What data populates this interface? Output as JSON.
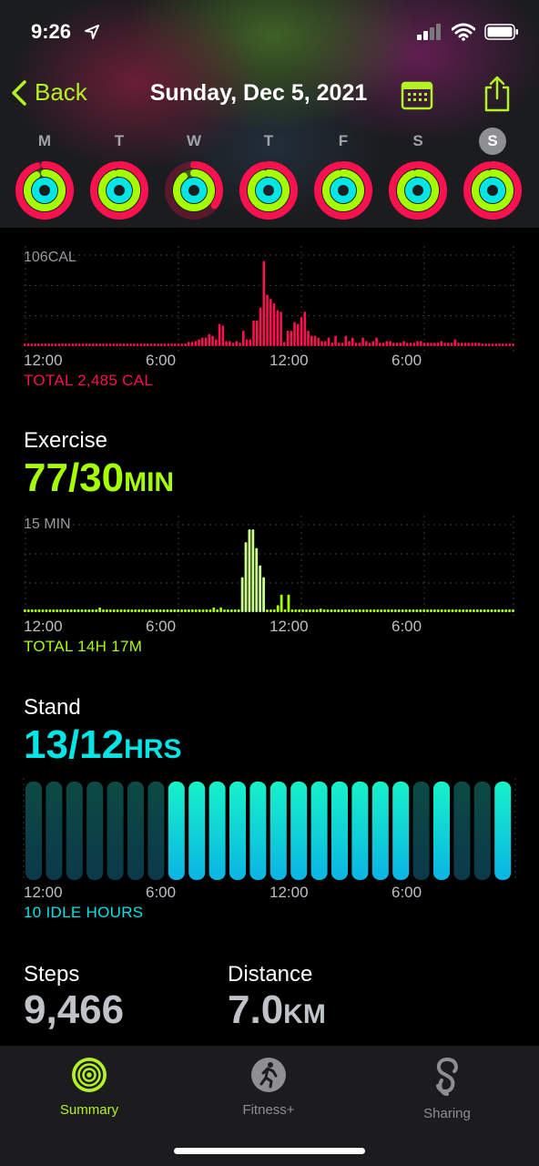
{
  "status": {
    "time": "9:26"
  },
  "nav": {
    "back_label": "Back",
    "title": "Sunday, Dec 5, 2021"
  },
  "week": [
    {
      "letter": "M",
      "selected": false,
      "move": 0.95,
      "exercise": 0.92,
      "stand": 0.95
    },
    {
      "letter": "T",
      "selected": false,
      "move": 0.97,
      "exercise": 0.95,
      "stand": 0.95
    },
    {
      "letter": "W",
      "selected": false,
      "move": 0.35,
      "exercise": 0.9,
      "stand": 0.95
    },
    {
      "letter": "T",
      "selected": false,
      "move": 0.97,
      "exercise": 0.95,
      "stand": 0.95
    },
    {
      "letter": "F",
      "selected": false,
      "move": 0.97,
      "exercise": 0.95,
      "stand": 0.95
    },
    {
      "letter": "S",
      "selected": false,
      "move": 0.97,
      "exercise": 0.95,
      "stand": 0.95
    },
    {
      "letter": "S",
      "selected": true,
      "move": 0.97,
      "exercise": 0.95,
      "stand": 0.95
    }
  ],
  "colors": {
    "move": "#fa114f",
    "exercise": "#a6ff00",
    "stand": "#00e5e6",
    "accent": "#b3f227"
  },
  "move": {
    "top_label": "106CAL",
    "ticks": [
      "12:00",
      "6:00",
      "12:00",
      "6:00"
    ],
    "total": "TOTAL 2,485 CAL"
  },
  "exercise": {
    "title": "Exercise",
    "value": "77/30",
    "unit": "MIN",
    "top_label": "15 MIN",
    "ticks": [
      "12:00",
      "6:00",
      "12:00",
      "6:00"
    ],
    "total": "TOTAL 14H 17M"
  },
  "stand": {
    "title": "Stand",
    "value": "13/12",
    "unit": "HRS",
    "ticks": [
      "12:00",
      "6:00",
      "12:00",
      "6:00"
    ],
    "total": "10 IDLE HOURS"
  },
  "steps": {
    "label": "Steps",
    "value": "9,466"
  },
  "distance": {
    "label": "Distance",
    "value": "7.0",
    "unit": "KM"
  },
  "tabs": [
    {
      "label": "Summary",
      "active": true
    },
    {
      "label": "Fitness+",
      "active": false
    },
    {
      "label": "Sharing",
      "active": false
    }
  ],
  "chart_data": [
    {
      "type": "bar",
      "name": "move",
      "ymax": 106,
      "values": [
        3,
        3,
        3,
        3,
        3,
        3,
        3,
        3,
        3,
        3,
        3,
        3,
        3,
        3,
        3,
        3,
        3,
        3,
        3,
        3,
        3,
        3,
        3,
        3,
        3,
        3,
        3,
        3,
        3,
        3,
        3,
        3,
        3,
        3,
        3,
        3,
        3,
        3,
        3,
        3,
        3,
        3,
        3,
        3,
        3,
        3,
        3,
        3,
        5,
        5,
        6,
        8,
        10,
        10,
        14,
        12,
        8,
        26,
        24,
        6,
        6,
        4,
        6,
        4,
        18,
        8,
        8,
        30,
        30,
        45,
        99,
        60,
        55,
        50,
        42,
        40,
        5,
        18,
        18,
        28,
        26,
        34,
        40,
        18,
        12,
        12,
        10,
        6,
        6,
        10,
        4,
        12,
        4,
        4,
        12,
        6,
        10,
        4,
        4,
        10,
        6,
        4,
        6,
        10,
        4,
        4,
        6,
        6,
        4,
        4,
        4,
        6,
        4,
        4,
        4,
        6,
        6,
        4,
        4,
        4,
        4,
        4,
        6,
        4,
        4,
        4,
        8,
        4,
        4,
        4,
        4,
        4,
        4,
        4,
        3,
        3,
        3,
        3,
        3,
        3,
        3,
        3,
        3,
        3
      ]
    },
    {
      "type": "bar",
      "name": "exercise",
      "ymax": 15,
      "values": [
        0.3,
        0.3,
        0.3,
        0.3,
        0.3,
        0.3,
        0.3,
        0.3,
        0.3,
        0.3,
        0.3,
        0.3,
        0.3,
        0.3,
        0.3,
        0.3,
        0.3,
        0.3,
        0.3,
        0.3,
        0.3,
        0.8,
        0.3,
        0.3,
        0.3,
        0.3,
        0.3,
        0.3,
        0.3,
        0.3,
        0.3,
        0.3,
        0.3,
        0.3,
        0.3,
        0.3,
        0.3,
        0.3,
        0.3,
        0.3,
        0.3,
        0.3,
        0.3,
        0.3,
        0.3,
        0.3,
        0.3,
        0.3,
        0.3,
        0.3,
        0.3,
        0.3,
        0.3,
        0.8,
        0.3,
        0.8,
        0.3,
        0.3,
        0.3,
        0.3,
        0.3,
        6,
        12,
        14.2,
        14.2,
        11,
        8,
        6,
        0.3,
        0.3,
        0.3,
        1.2,
        3,
        0.3,
        3,
        0.3,
        0.3,
        0.3,
        0.3,
        0.3,
        0.3,
        0.3,
        0.3,
        0.6,
        0.3,
        0.3,
        0.3,
        0.3,
        0.3,
        0.3,
        0.3,
        0.3,
        0.3,
        0.3,
        0.3,
        0.3,
        0.3,
        0.3,
        0.3,
        0.3,
        0.3,
        0.3,
        0.3,
        0.3,
        0.3,
        0.3,
        0.3,
        0.3,
        0.3,
        0.3,
        0.3,
        0.3,
        0.3,
        0.3,
        0.3,
        0.3,
        0.3,
        0.3,
        0.3,
        0.3,
        0.3,
        0.3,
        0.3,
        0.3,
        0.3,
        0.3,
        0.3,
        0.3,
        0.3,
        0.3,
        0.3,
        0.3,
        0.3,
        0.3,
        0.3,
        0.3,
        0.3,
        0.3
      ]
    },
    {
      "type": "bar",
      "name": "stand",
      "hours_stood": [
        0,
        0,
        0,
        0,
        0,
        0,
        0,
        1,
        1,
        1,
        1,
        1,
        1,
        1,
        1,
        1,
        1,
        1,
        1,
        0,
        1,
        0,
        0,
        1
      ]
    }
  ]
}
